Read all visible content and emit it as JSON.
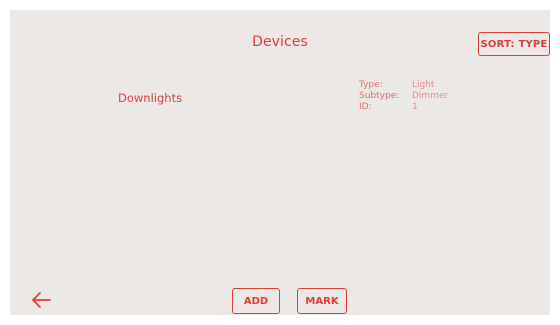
{
  "header": {
    "title": "Devices",
    "sort_label": "SORT: TYPE"
  },
  "devices": [
    {
      "name": "Downlights",
      "properties": [
        {
          "label": "Type:",
          "value": "Light"
        },
        {
          "label": "Subtype:",
          "value": "Dimmer"
        },
        {
          "label": "ID:",
          "value": "1"
        }
      ]
    }
  ],
  "footer": {
    "back_icon": "arrow-left-icon",
    "add_label": "ADD",
    "mark_label": "MARK"
  },
  "colors": {
    "accent": "#e03c3c",
    "background": "#ece8e6"
  }
}
